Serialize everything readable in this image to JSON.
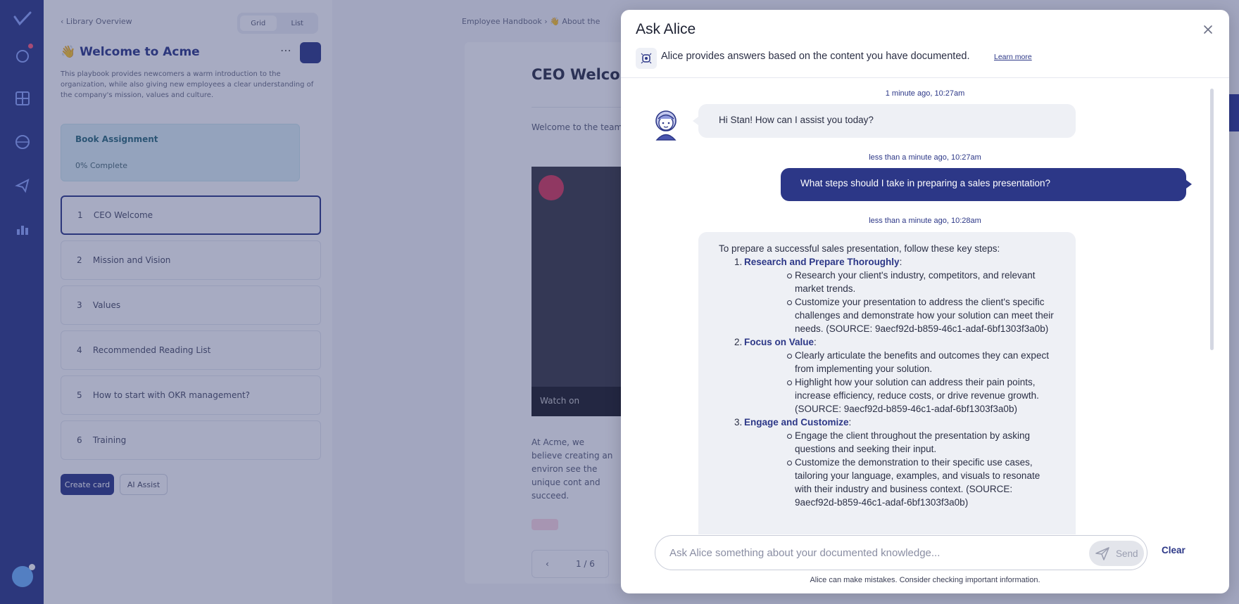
{
  "background": {
    "library": {
      "back_label": "Library Overview",
      "view_options": [
        "Grid",
        "List"
      ],
      "title": "👋 Welcome to Acme",
      "description": "This playbook provides newcomers a warm introduction to the organization, while also giving new employees a clear understanding of the company's mission, values and culture.",
      "assignment_title": "Book Assignment",
      "assignment_status": "0% Complete",
      "items": [
        {
          "num": "1",
          "label": "CEO Welcome"
        },
        {
          "num": "2",
          "label": "Mission and Vision"
        },
        {
          "num": "3",
          "label": "Values"
        },
        {
          "num": "4",
          "label": "Recommended Reading List"
        },
        {
          "num": "5",
          "label": "How to start with OKR management?"
        },
        {
          "num": "6",
          "label": "Training"
        }
      ],
      "create_label": "Create card",
      "ai_label": "AI Assist"
    },
    "document": {
      "breadcrumb": "Employee Handbook  ›  👋 About the",
      "title": "CEO Welco",
      "intro": "Welcome to the team! excitement and inspi",
      "video_caption": "Watch on",
      "body": "At Acme, we believe creating an environ see the unique cont and succeed.",
      "pager": "1 / 6"
    }
  },
  "modal": {
    "title": "Ask Alice",
    "info_text": "Alice provides answers based on the content you have documented.",
    "learn_more": "Learn more",
    "messages": {
      "greeting_time": "1 minute ago, 10:27am",
      "greeting": "Hi Stan! How can I assist you today?",
      "question_time": "less than a minute ago, 10:27am",
      "question": "What steps should I take in preparing a sales presentation?",
      "answer_time": "less than a minute ago, 10:28am",
      "answer": {
        "intro": "To prepare a successful sales presentation, follow these key steps:",
        "steps": [
          {
            "num": "1.",
            "title": "Research and Prepare Thoroughly",
            "points": [
              "Research your client's industry, competitors, and relevant market trends.",
              "Customize your presentation to address the client's specific challenges and demonstrate how your solution can meet their needs. (SOURCE: 9aecf92d-b859-46c1-adaf-6bf1303f3a0b)"
            ]
          },
          {
            "num": "2.",
            "title": "Focus on Value",
            "points": [
              "Clearly articulate the benefits and outcomes they can expect from implementing your solution.",
              "Highlight how your solution can address their pain points, increase efficiency, reduce costs, or drive revenue growth. (SOURCE: 9aecf92d-b859-46c1-adaf-6bf1303f3a0b)"
            ]
          },
          {
            "num": "3.",
            "title": "Engage and Customize",
            "points": [
              "Engage the client throughout the presentation by asking questions and seeking their input.",
              "Customize the demonstration to their specific use cases, tailoring your language, examples, and visuals to resonate with their industry and business context. (SOURCE: 9aecf92d-b859-46c1-adaf-6bf1303f3a0b)"
            ]
          }
        ]
      }
    },
    "composer": {
      "placeholder": "Ask Alice something about your documented knowledge...",
      "send_label": "Send",
      "clear_label": "Clear"
    },
    "disclaimer": "Alice can make mistakes. Consider checking important information."
  },
  "colors": {
    "brand": "#2c3787",
    "bot_bubble": "#eef0f5",
    "user_bubble": "#2c3787"
  },
  "icons": [
    "logo-icon",
    "rocket-icon",
    "grid-icon",
    "globe-icon",
    "share-icon",
    "chart-icon",
    "close-icon",
    "brain-icon",
    "send-icon",
    "lightbulb-icon"
  ]
}
